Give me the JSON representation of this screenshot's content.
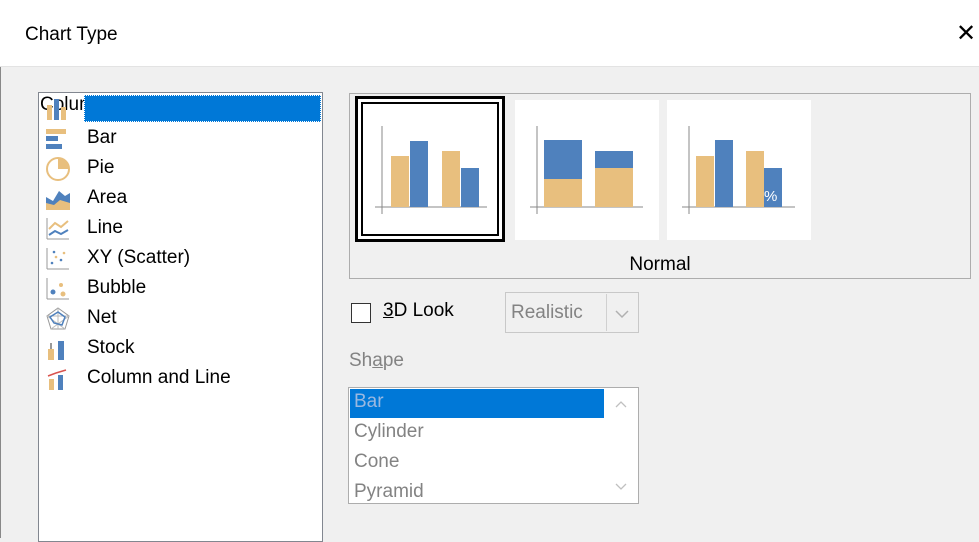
{
  "dialog": {
    "title": "Chart Type",
    "close_glyph": "✕"
  },
  "chart_types": [
    {
      "label": "Column",
      "icon": "column-chart-icon",
      "selected": true
    },
    {
      "label": "Bar",
      "icon": "bar-chart-icon"
    },
    {
      "label": "Pie",
      "icon": "pie-chart-icon"
    },
    {
      "label": "Area",
      "icon": "area-chart-icon"
    },
    {
      "label": "Line",
      "icon": "line-chart-icon"
    },
    {
      "label": "XY (Scatter)",
      "icon": "scatter-chart-icon"
    },
    {
      "label": "Bubble",
      "icon": "bubble-chart-icon"
    },
    {
      "label": "Net",
      "icon": "net-chart-icon"
    },
    {
      "label": "Stock",
      "icon": "stock-chart-icon"
    },
    {
      "label": "Column and Line",
      "icon": "column-line-chart-icon"
    }
  ],
  "variants": {
    "selected_name": "Normal",
    "items": [
      "normal",
      "stacked",
      "percent-stacked"
    ],
    "percent_glyph": "%"
  },
  "look3d": {
    "label_prefix": "",
    "label_accel": "3",
    "label_rest": "D Look",
    "checked": false,
    "style_value": "Realistic"
  },
  "shape": {
    "label_a": "Sh",
    "label_accel": "a",
    "label_b": "pe",
    "options": [
      "Bar",
      "Cylinder",
      "Cone",
      "Pyramid"
    ],
    "selected": "Bar"
  },
  "colors": {
    "accent": "#0078d7",
    "series_a": "#e8bf7e",
    "series_b": "#4f81bd"
  }
}
